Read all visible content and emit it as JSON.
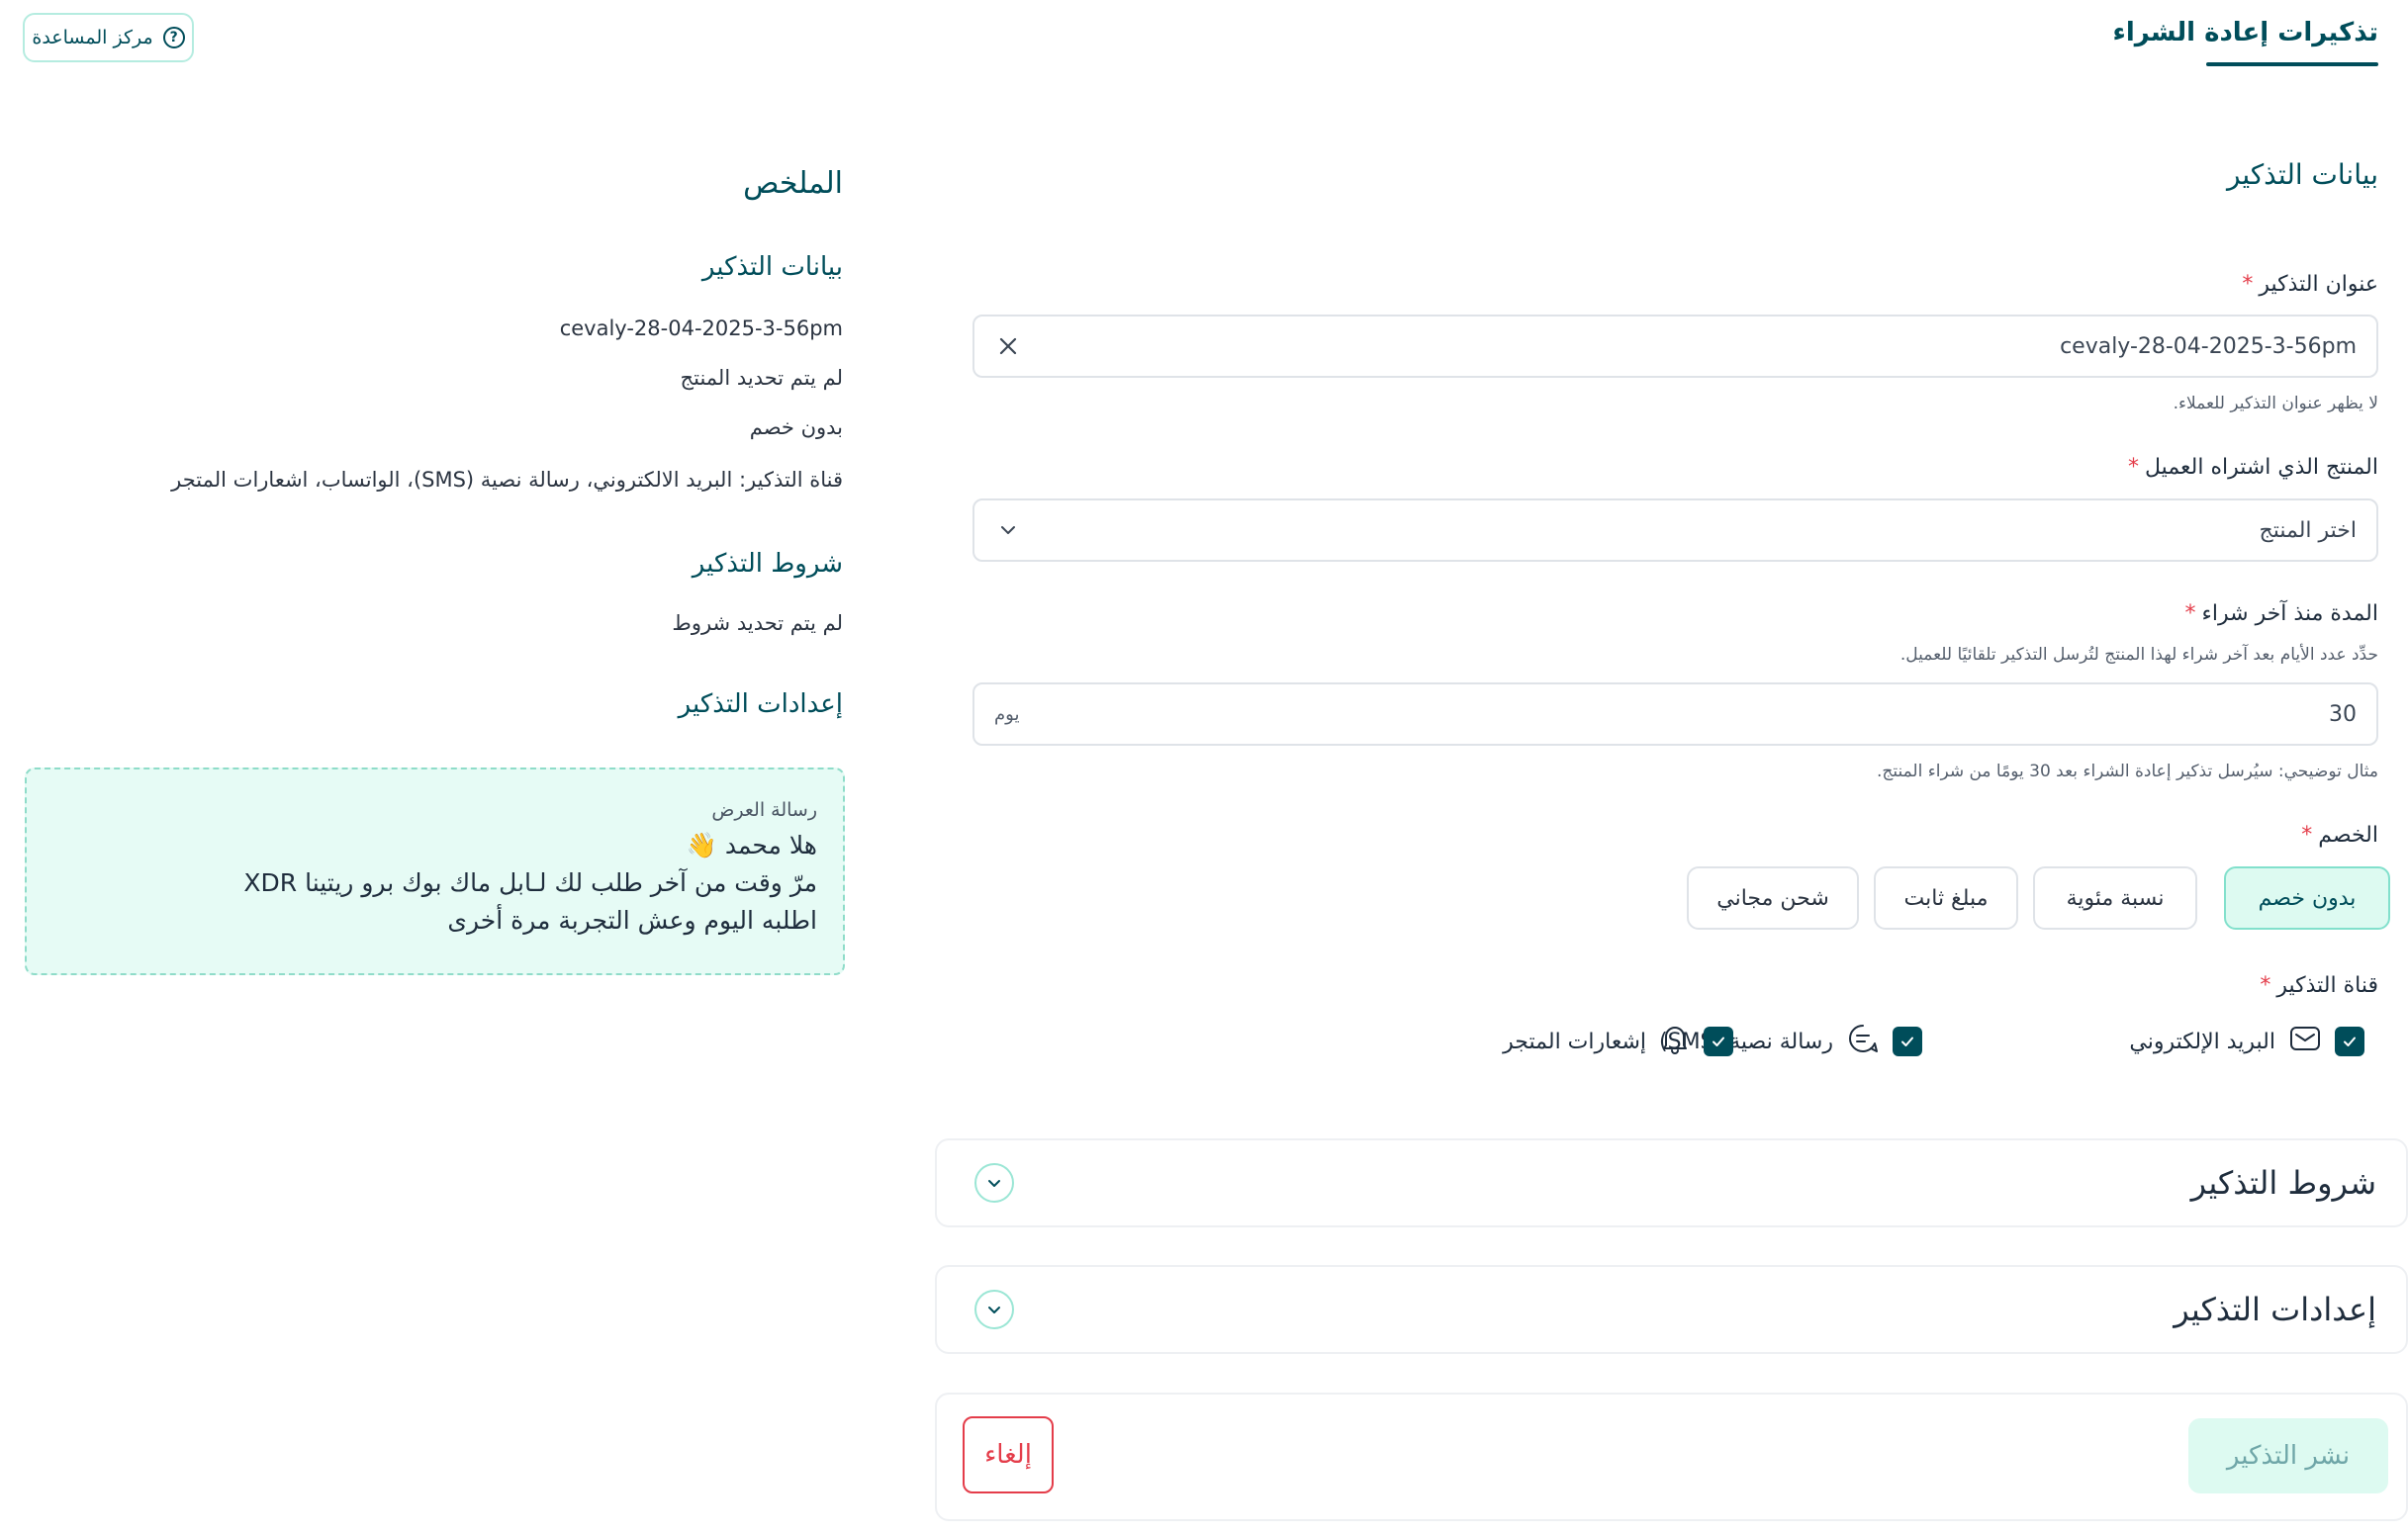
{
  "header": {
    "title": "تذكيرات إعادة الشراء",
    "help_label": "مركز المساعدة"
  },
  "form": {
    "section_title": "بيانات التذكير",
    "reminder_title": {
      "label": "عنوان التذكير",
      "value": "cevaly-28-04-2025-3-56pm",
      "hint": "لا يظهر عنوان التذكير للعملاء."
    },
    "product": {
      "label": "المنتج الذي اشتراه العميل",
      "placeholder": "اختر المنتج"
    },
    "period": {
      "label": "المدة منذ آخر شراء",
      "description": "حدِّد عدد الأيام بعد آخر شراء لهذا المنتج لتُرسل التذكير تلقائيًا للعميل.",
      "value": "30",
      "unit": "يوم",
      "example": "مثال توضيحي: سيُرسل تذكير إعادة الشراء بعد 30 يومًا من شراء المنتج."
    },
    "discount": {
      "label": "الخصم",
      "options": [
        "بدون خصم",
        "نسبة مئوية",
        "مبلغ ثابت",
        "شحن مجاني"
      ],
      "selected": "بدون خصم"
    },
    "channel": {
      "label": "قناة التذكير",
      "options": [
        {
          "label": "البريد الإلكتروني",
          "icon": "envelope-icon",
          "checked": true
        },
        {
          "label": "رسالة نصية (SMS)",
          "icon": "chat-icon",
          "checked": true
        },
        {
          "label": "إشعارات المتجر",
          "icon": "bell-icon",
          "checked": true
        }
      ]
    },
    "conditions_title": "شروط التذكير",
    "settings_title": "إعدادات التذكير",
    "publish_label": "نشر التذكير",
    "cancel_label": "إلغاء"
  },
  "summary": {
    "title": "الملخص",
    "data_heading": "بيانات التذكير",
    "data_lines": [
      "cevaly-28-04-2025-3-56pm",
      "لم يتم تحديد المنتج",
      "بدون خصم",
      "قناة التذكير: البريد الالكتروني، رسالة نصية (SMS)، الواتساب، اشعارات المتجر"
    ],
    "conditions_heading": "شروط التذكير",
    "conditions_text": "لم يتم تحديد شروط",
    "settings_heading": "إعدادات التذكير",
    "preview": {
      "label": "رسالة العرض",
      "lines": [
        "هلا محمد 👋",
        "مرّ وقت من آخر طلب لك لـابل ماك بوك برو ريتينا XDR",
        "اطلبه اليوم وعش التجربة مرة أخرى"
      ]
    }
  },
  "colors": {
    "brand": "#004d5a",
    "accent_light": "#ddfaf1",
    "danger": "#e43d4a"
  }
}
